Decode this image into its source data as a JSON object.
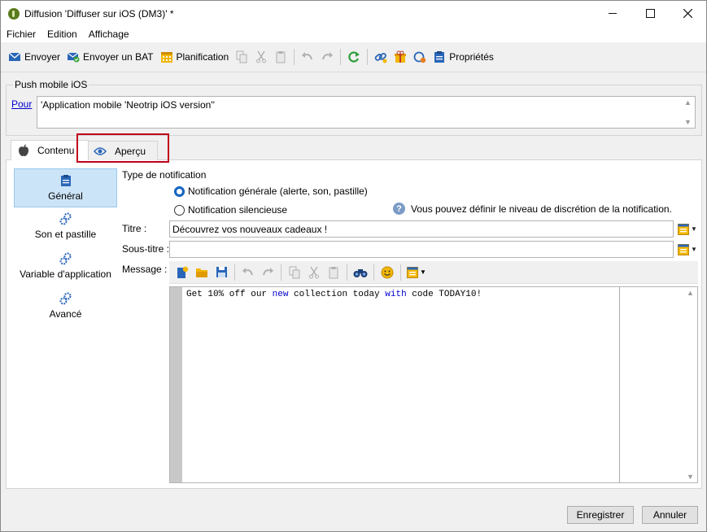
{
  "window": {
    "title": "Diffusion 'Diffuser sur iOS (DM3)' *"
  },
  "menu": [
    "Fichier",
    "Edition",
    "Affichage"
  ],
  "toolbar": {
    "send": "Envoyer",
    "send_bat": "Envoyer un BAT",
    "schedule": "Planification",
    "properties": "Propriétés"
  },
  "push_group": {
    "title": "Push mobile iOS",
    "pour_label": "Pour",
    "pour_value": "'Application mobile 'Neotrip iOS version''"
  },
  "tabs": {
    "content": "Contenu",
    "preview": "Aperçu"
  },
  "sidebar": {
    "items": [
      {
        "label": "Général",
        "icon": "clipboard-icon",
        "selected": true
      },
      {
        "label": "Son et pastille",
        "icon": "gears-icon"
      },
      {
        "label": "Variable d'application",
        "icon": "gears-icon"
      },
      {
        "label": "Avancé",
        "icon": "gears-icon"
      }
    ]
  },
  "notification": {
    "type_label": "Type de notification",
    "option_general": "Notification générale (alerte, son, pastille)",
    "option_silent": "Notification silencieuse",
    "selected": "general",
    "help_text": "Vous pouvez définir le niveau de discrétion de la notification."
  },
  "fields": {
    "title_label": "Titre :",
    "title_value": "Découvrez vos nouveaux cadeaux !",
    "subtitle_label": "Sous-titre :",
    "subtitle_value": "",
    "message_label": "Message :"
  },
  "message": {
    "part1": "Get 10% off our ",
    "kw1": "new",
    "part2": " collection today ",
    "kw2": "with",
    "part3": " code TODAY10!"
  },
  "buttons": {
    "save": "Enregistrer",
    "cancel": "Annuler"
  },
  "colors": {
    "highlight": "#c0001a",
    "selected_side": "#cce4f7",
    "keyword": "#0000cc"
  }
}
